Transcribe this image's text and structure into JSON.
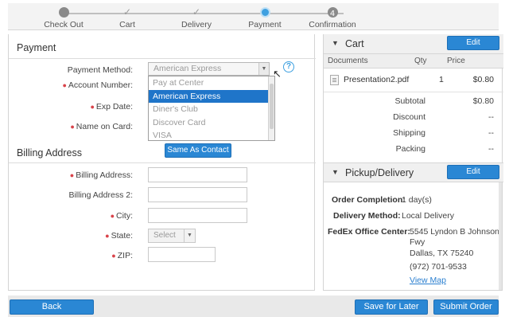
{
  "steps": [
    {
      "label": "Check Out",
      "state": "grey",
      "glyph": ""
    },
    {
      "label": "Cart",
      "state": "done",
      "glyph": "✓"
    },
    {
      "label": "Delivery",
      "state": "done",
      "glyph": "✓"
    },
    {
      "label": "Payment",
      "state": "active",
      "glyph": ""
    },
    {
      "label": "Confirmation",
      "state": "grey",
      "glyph": "4"
    }
  ],
  "payment": {
    "title": "Payment",
    "method_label": "Payment Method:",
    "method_value": "American Express",
    "account_label": "Account Number:",
    "exp_label": "Exp Date:",
    "name_label": "Name on Card:",
    "options": [
      "Pay at Center",
      "American Express",
      "Diner's Club",
      "Discover Card",
      "VISA"
    ],
    "selected_option": "American Express"
  },
  "billing": {
    "title": "Billing Address",
    "same_as_contact": "Same As Contact",
    "address_label": "Billing Address:",
    "address2_label": "Billing Address 2:",
    "city_label": "City:",
    "state_label": "State:",
    "state_placeholder": "Select",
    "zip_label": "ZIP:"
  },
  "cart": {
    "title": "Cart",
    "edit": "Edit",
    "columns": {
      "documents": "Documents",
      "qty": "Qty",
      "price": "Price"
    },
    "items": [
      {
        "name": "Presentation2.pdf",
        "qty": "1",
        "price": "$0.80"
      }
    ],
    "summary": {
      "subtotal_label": "Subtotal",
      "subtotal": "$0.80",
      "discount_label": "Discount",
      "discount": "--",
      "shipping_label": "Shipping",
      "shipping": "--",
      "packing_label": "Packing",
      "packing": "--"
    }
  },
  "pickup": {
    "title": "Pickup/Delivery",
    "edit": "Edit",
    "completion_label": "Order Completion:",
    "completion": "1 day(s)",
    "method_label": "Delivery Method:",
    "method": "Local Delivery",
    "center_label": "FedEx Office Center:",
    "address_line1": "5545 Lyndon B Johnson",
    "address_line2": "Fwy",
    "address_line3": "Dallas, TX 75240",
    "phone": "(972) 701-9533",
    "map_link": "View Map"
  },
  "footer": {
    "back": "Back",
    "save_later": "Save for Later",
    "submit": "Submit Order"
  },
  "colors": {
    "accent": "#2a87d4",
    "required": "#d9434a",
    "selected": "#1f75c9"
  }
}
